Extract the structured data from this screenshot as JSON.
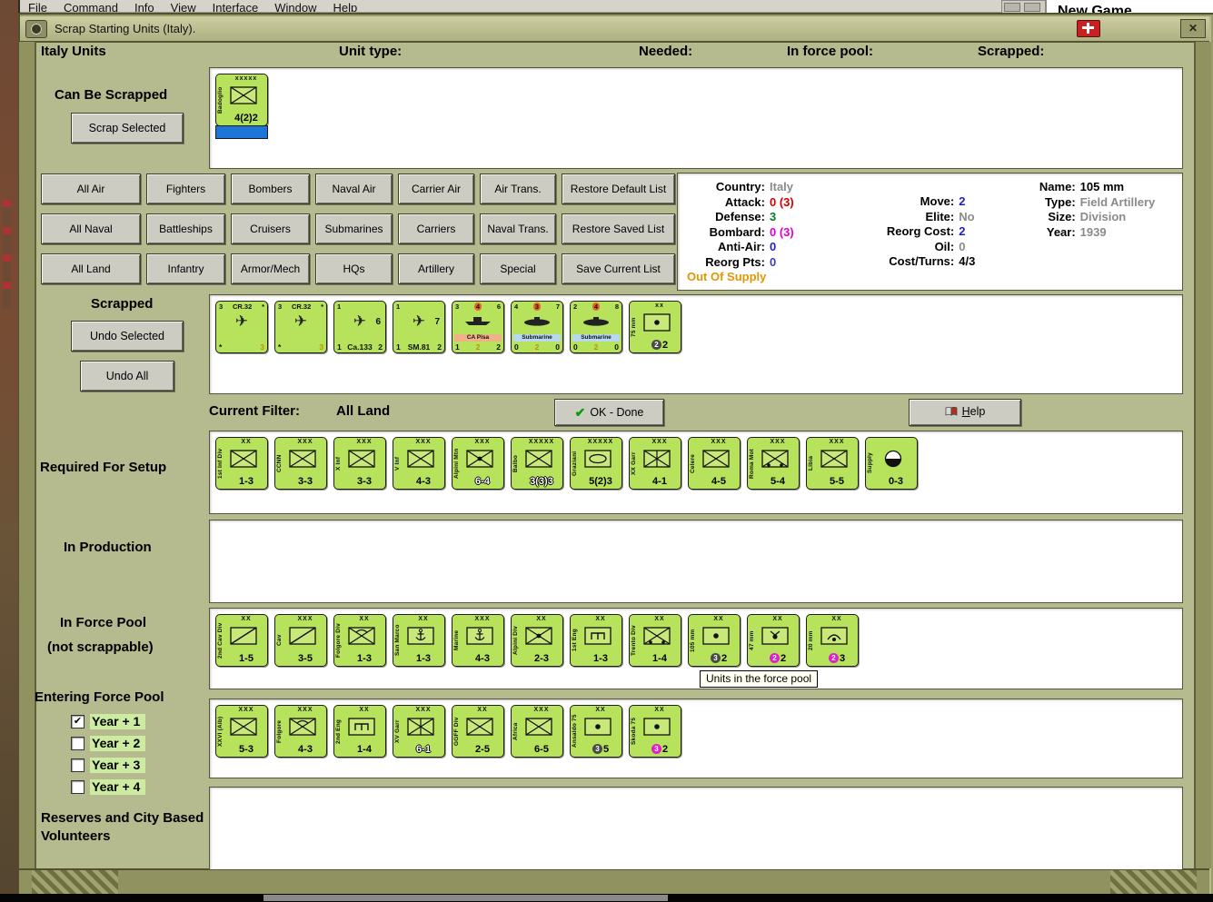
{
  "chrome": {
    "menu_items": [
      "File",
      "Command",
      "Info",
      "View",
      "Interface",
      "Window",
      "Help"
    ],
    "background_window_title": "New Game",
    "title": "Scrap Starting Units (Italy)."
  },
  "header": {
    "italy_units": "Italy Units",
    "unit_type": "Unit type:",
    "needed": "Needed:",
    "in_force_pool": "In force pool:",
    "scrapped": "Scrapped:"
  },
  "buttons": {
    "scrap_selected": "Scrap Selected",
    "undo_selected": "Undo Selected",
    "undo_all": "Undo All",
    "ok_done": "OK - Done",
    "help": "Help"
  },
  "filters": {
    "rows": [
      [
        "All Air",
        "Fighters",
        "Bombers",
        "Naval Air",
        "Carrier Air",
        "Air Trans.",
        "Restore Default List"
      ],
      [
        "All Naval",
        "Battleships",
        "Cruisers",
        "Submarines",
        "Carriers",
        "Naval Trans.",
        "Restore Saved List"
      ],
      [
        "All Land",
        "Infantry",
        "Armor/Mech",
        "HQs",
        "Artillery",
        "Special",
        "Save Current List"
      ]
    ],
    "current_label": "Current Filter:",
    "current_value": "All Land"
  },
  "info_panel": {
    "col1": [
      {
        "label": "Country:",
        "value": "Italy",
        "color": "#8a8a8a"
      },
      {
        "label": "Attack:",
        "value": "0 (3)",
        "color": "#d40000"
      },
      {
        "label": "Defense:",
        "value": "3",
        "color": "#007a2a"
      },
      {
        "label": "Bombard:",
        "value": "0 (3)",
        "color": "#e000d0"
      },
      {
        "label": "Anti-Air:",
        "value": "0",
        "color": "#2020c8"
      },
      {
        "label": "Reorg Pts:",
        "value": "0",
        "color": "#4038c0"
      }
    ],
    "supply_status": "Out Of Supply",
    "supply_color": "#e69500",
    "col2": [
      {
        "label": "Move:",
        "value": "2",
        "color": "#2020c8"
      },
      {
        "label": "Elite:",
        "value": "No",
        "color": "#8a8a8a"
      },
      {
        "label": "Reorg Cost:",
        "value": "2",
        "color": "#2020c8"
      },
      {
        "label": "Oil:",
        "value": "0",
        "color": "#8a8a8a"
      },
      {
        "label": "Cost/Turns:",
        "value": "4/3",
        "color": "#000000"
      }
    ],
    "col3": [
      {
        "label": "Name:",
        "value": "105 mm",
        "color": "#000000",
        "bold": true
      },
      {
        "label": "Type:",
        "value": "Field Artillery",
        "color": "#8a8a8a"
      },
      {
        "label": "Size:",
        "value": "Division",
        "color": "#8a8a8a"
      },
      {
        "label": "Year:",
        "value": "1939",
        "color": "#8a8a8a"
      }
    ]
  },
  "sections": {
    "can_be_scrapped": {
      "label": "Can Be Scrapped",
      "units": [
        {
          "label": "Badoglio",
          "size": "xxxxx",
          "symbol": "inf",
          "stats": "4(2)2",
          "selected": true
        }
      ]
    },
    "scrapped": {
      "label": "Scrapped",
      "units": [
        {
          "top": [
            {
              "t": "3"
            },
            {
              "t": "CR.32"
            },
            {
              "t": "*"
            }
          ],
          "symbol": "plane",
          "bottom": [
            {
              "t": "*"
            },
            {
              "t": "3",
              "hl": "yellow"
            }
          ]
        },
        {
          "top": [
            {
              "t": "3"
            },
            {
              "t": "CR.32"
            },
            {
              "t": "*"
            }
          ],
          "symbol": "plane",
          "bottom": [
            {
              "t": "*"
            },
            {
              "t": "3",
              "hl": "yellow"
            }
          ]
        },
        {
          "top": [
            {
              "t": "1"
            }
          ],
          "mid": "6",
          "symbol": "plane",
          "bottom": [
            {
              "t": "1"
            },
            {
              "t": "Ca.133"
            },
            {
              "t": "2"
            }
          ]
        },
        {
          "top": [
            {
              "t": "1"
            }
          ],
          "mid": "7",
          "symbol": "plane",
          "bottom": [
            {
              "t": "1"
            },
            {
              "t": "SM.81"
            },
            {
              "t": "2"
            }
          ]
        },
        {
          "top": [
            {
              "t": "3"
            },
            {
              "t": "4",
              "hl": "red"
            },
            {
              "t": "6"
            }
          ],
          "symbol": "ship",
          "name": "CA Pisa",
          "band": "#f0b088",
          "bottom": [
            {
              "t": "1"
            },
            {
              "t": "2",
              "hl": "yellow"
            },
            {
              "t": "2"
            }
          ]
        },
        {
          "top": [
            {
              "t": "4"
            },
            {
              "t": "3",
              "hl": "red"
            },
            {
              "t": "7"
            }
          ],
          "symbol": "sub",
          "name": "Submarine",
          "band": "#b8d8f0",
          "bottom": [
            {
              "t": "0"
            },
            {
              "t": "2",
              "hl": "yellow"
            },
            {
              "t": "0"
            }
          ]
        },
        {
          "top": [
            {
              "t": "2"
            },
            {
              "t": "4",
              "hl": "red"
            },
            {
              "t": "8"
            }
          ],
          "symbol": "sub",
          "name": "Submarine",
          "band": "#b8d8f0",
          "bottom": [
            {
              "t": "0"
            },
            {
              "t": "2",
              "hl": "yellow"
            },
            {
              "t": "0"
            }
          ]
        },
        {
          "label": "75 mm",
          "size": "xx",
          "symbol": "art",
          "stats": "2",
          "badge": {
            "text": "2",
            "color": "gray"
          }
        }
      ]
    },
    "required": {
      "label": "Required For Setup",
      "units": [
        {
          "label": "1st Inf Div",
          "size": "XX",
          "symbol": "inf",
          "stats": "1-3"
        },
        {
          "label": "CCNN",
          "size": "XXX",
          "symbol": "inf",
          "stats": "3-3"
        },
        {
          "label": "X Inf",
          "size": "XXX",
          "symbol": "inf",
          "stats": "3-3"
        },
        {
          "label": "V Inf",
          "size": "XXX",
          "symbol": "inf",
          "stats": "4-3"
        },
        {
          "label": "Alpini Mtn",
          "size": "XXX",
          "symbol": "mtn",
          "stats": "6-4",
          "outlined": true
        },
        {
          "label": "Balbo",
          "size": "XXXXX",
          "symbol": "inf",
          "stats": "3(3)3",
          "outlined": true
        },
        {
          "label": "Graziani",
          "size": "XXXXX",
          "symbol": "armor",
          "stats": "5(2)3"
        },
        {
          "label": "XX Garr",
          "size": "XXX",
          "symbol": "garrison",
          "stats": "4-1"
        },
        {
          "label": "Celere",
          "size": "XXX",
          "symbol": "inf",
          "stats": "4-5"
        },
        {
          "label": "Roma Mot",
          "size": "XXX",
          "symbol": "mot",
          "stats": "5-4"
        },
        {
          "label": "Libia",
          "size": "XXX",
          "symbol": "inf",
          "stats": "5-5"
        },
        {
          "label": "Supply",
          "size": "",
          "symbol": "supply",
          "stats": "0-3"
        }
      ]
    },
    "in_production": {
      "label": "In Production",
      "units": []
    },
    "force_pool": {
      "label": "In Force Pool",
      "sublabel": "(not scrappable)",
      "tooltip": "Units in the force pool",
      "units": [
        {
          "label": "2nd Cav Div",
          "size": "XX",
          "symbol": "cav",
          "stats": "1-5"
        },
        {
          "label": "Cav",
          "size": "XXX",
          "symbol": "cav",
          "stats": "3-5"
        },
        {
          "label": "Folgore Div",
          "size": "XX",
          "symbol": "para",
          "stats": "1-3"
        },
        {
          "label": "San Marco",
          "size": "XX",
          "symbol": "marine",
          "stats": "1-3"
        },
        {
          "label": "Marine",
          "size": "XXX",
          "symbol": "marine",
          "stats": "4-3"
        },
        {
          "label": "Alpini Div",
          "size": "XX",
          "symbol": "mtn",
          "stats": "2-3"
        },
        {
          "label": "1st Eng",
          "size": "XX",
          "symbol": "eng",
          "stats": "1-3"
        },
        {
          "label": "Trento Div",
          "size": "XX",
          "symbol": "mot",
          "stats": "1-4"
        },
        {
          "label": "105 mm",
          "size": "XX",
          "symbol": "art",
          "stats": "2",
          "badge": {
            "text": "3",
            "color": "gray"
          }
        },
        {
          "label": "47 mm",
          "size": "XX",
          "symbol": "at",
          "stats": "2",
          "badge": {
            "text": "2",
            "color": "magenta"
          }
        },
        {
          "label": "20 mm",
          "size": "XX",
          "symbol": "aa",
          "stats": "3",
          "badge": {
            "text": "2",
            "color": "magenta"
          }
        }
      ]
    },
    "entering": {
      "label": "Entering Force Pool",
      "checkboxes": [
        {
          "label": "Year + 1",
          "checked": true
        },
        {
          "label": "Year + 2",
          "checked": false
        },
        {
          "label": "Year + 3",
          "checked": false
        },
        {
          "label": "Year + 4",
          "checked": false
        }
      ],
      "units": [
        {
          "label": "XXVI (Alb)",
          "size": "XXX",
          "symbol": "inf",
          "stats": "5-3"
        },
        {
          "label": "Folgore",
          "size": "XXX",
          "symbol": "para",
          "stats": "4-3"
        },
        {
          "label": "2nd Eng",
          "size": "XX",
          "symbol": "eng",
          "stats": "1-4"
        },
        {
          "label": "XV Garr",
          "size": "XXX",
          "symbol": "garrison",
          "stats": "6-1",
          "outlined": true
        },
        {
          "label": "GGFF Div",
          "size": "XX",
          "symbol": "inf",
          "stats": "2-5"
        },
        {
          "label": "Africa",
          "size": "XXX",
          "symbol": "inf",
          "stats": "6-5"
        },
        {
          "label": "Ansaldo 75",
          "size": "XX",
          "symbol": "art",
          "stats": "5",
          "badge": {
            "text": "3",
            "color": "gray"
          }
        },
        {
          "label": "Skoda 75",
          "size": "XX",
          "symbol": "art",
          "stats": "2",
          "badge": {
            "text": "3",
            "color": "magenta"
          }
        }
      ]
    },
    "reserves": {
      "label": "Reserves and City Based Volunteers",
      "units": []
    }
  }
}
